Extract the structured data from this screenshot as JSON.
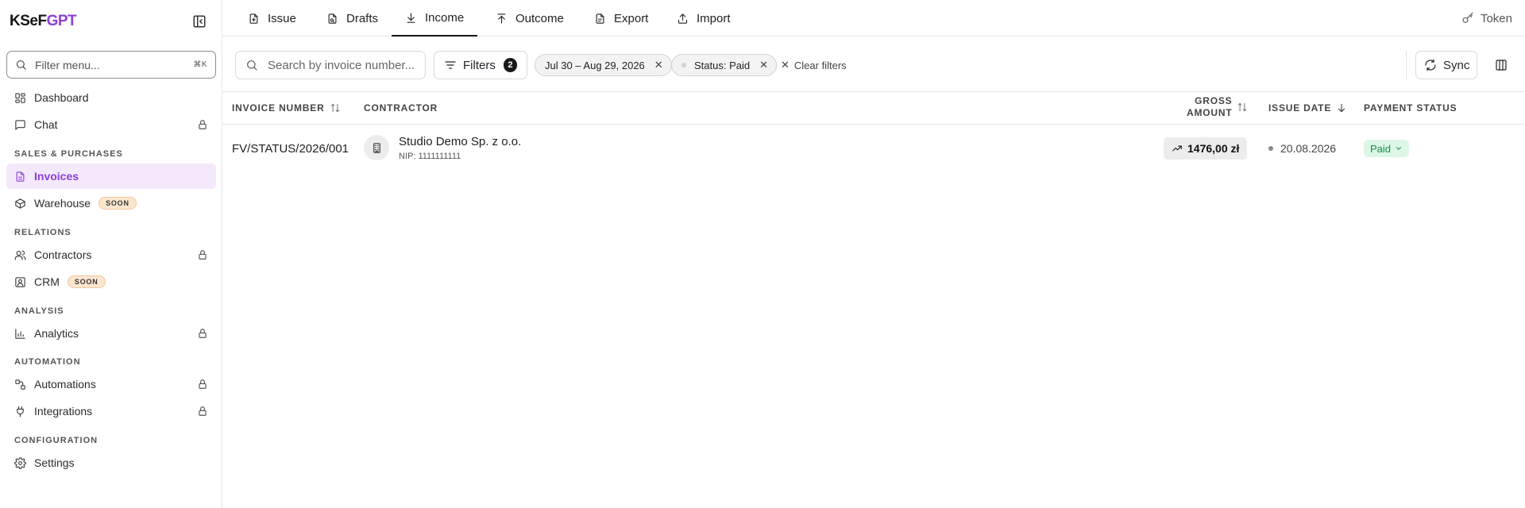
{
  "brand": {
    "prefix": "KSeF",
    "suffix": "GPT",
    "prefix_color": "#141414",
    "suffix_color": "#8b3fd9"
  },
  "sidebar": {
    "filter_placeholder": "Filter menu...",
    "filter_shortcut": "⌘K",
    "items": [
      {
        "label": "Dashboard",
        "icon": "dashboard-icon"
      },
      {
        "label": "Chat",
        "icon": "chat-icon",
        "locked": true
      },
      {
        "label": "Invoices",
        "icon": "document-icon",
        "active": true
      },
      {
        "label": "Warehouse",
        "icon": "box-icon",
        "badge": "SOON"
      },
      {
        "label": "Contractors",
        "icon": "users-icon",
        "locked": true
      },
      {
        "label": "CRM",
        "icon": "contact-icon",
        "badge": "SOON"
      },
      {
        "label": "Analytics",
        "icon": "bar-chart-icon",
        "locked": true
      },
      {
        "label": "Automations",
        "icon": "workflow-icon",
        "locked": true
      },
      {
        "label": "Integrations",
        "icon": "plug-icon",
        "locked": true
      },
      {
        "label": "Settings",
        "icon": "gear-icon"
      }
    ],
    "sections": {
      "sales": "SALES & PURCHASES",
      "relations": "RELATIONS",
      "analysis": "ANALYSIS",
      "automation": "AUTOMATION",
      "configuration": "CONFIGURATION"
    }
  },
  "tabs": [
    {
      "label": "Issue",
      "icon": "file-plus-icon"
    },
    {
      "label": "Drafts",
      "icon": "draft-icon"
    },
    {
      "label": "Income",
      "icon": "download-icon",
      "active": true
    },
    {
      "label": "Outcome",
      "icon": "upload-icon"
    },
    {
      "label": "Export",
      "icon": "export-icon"
    },
    {
      "label": "Import",
      "icon": "import-icon"
    }
  ],
  "token_label": "Token",
  "toolbar": {
    "search_placeholder": "Search by invoice number...",
    "filters_label": "Filters",
    "filters_count": "2",
    "chips": [
      {
        "label": "Jul 30 – Aug 29, 2026"
      },
      {
        "label": "Status: Paid"
      }
    ],
    "clear_filters": "Clear filters",
    "sync_label": "Sync"
  },
  "table": {
    "headers": {
      "invoice_number": "INVOICE NUMBER",
      "contractor": "CONTRACTOR",
      "gross_line1": "GROSS",
      "gross_line2": "AMOUNT",
      "issue_date": "ISSUE DATE",
      "payment_status": "PAYMENT STATUS"
    },
    "rows": [
      {
        "invoice_number": "FV/STATUS/2026/001",
        "contractor_name": "Studio Demo Sp. z o.o.",
        "contractor_nip": "NIP: 1111111111",
        "gross_amount": "1476,00 zł",
        "issue_date": "20.08.2026",
        "payment_status": "Paid"
      }
    ]
  },
  "colors": {
    "accent": "#8b3fd9",
    "active_bg": "#f3e8fc",
    "paid_bg": "#dcf7e6",
    "paid_text": "#1a8f4a",
    "soon_bg": "#fde6cf"
  }
}
